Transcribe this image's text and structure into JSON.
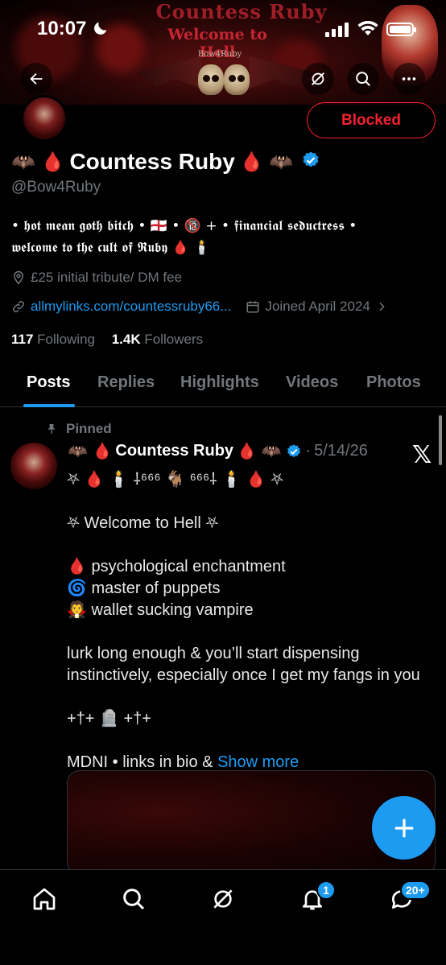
{
  "status_bar": {
    "time": "10:07"
  },
  "banner": {
    "title": "Countess Ruby",
    "subtitle": "Welcome to Hell",
    "tag": "Bow4Ruby"
  },
  "profile": {
    "display_name": "Countess Ruby",
    "name_prefix_emoji": "🦇 🩸",
    "name_suffix_emoji": "🩸 🦇",
    "handle": "@Bow4Ruby",
    "verified": true,
    "relationship_button": "Blocked",
    "bio_line1": "• 𝖍𝖔𝖙 𝖒𝖊𝖆𝖓 𝖌𝖔𝖙𝖍 𝖇𝖎𝖙𝖈𝖍 • 🏴󠁧󠁢󠁥󠁮󠁧󠁿 • 🔞 + • 𝖋𝖎𝖓𝖆𝖓𝖈𝖎𝖆𝖑 𝖘𝖊𝖉𝖚𝖈𝖙𝖗𝖊𝖘𝖘 •",
    "bio_line2": "𝖜𝖊𝖑𝖈𝖔𝖒𝖊 𝖙𝖔 𝖙𝖍𝖊 𝖈𝖚𝖑𝖙 𝖔𝖋 𝕽𝖚𝖇𝖞 🩸 🕯️",
    "location": "£25 initial tribute/ DM fee",
    "website": "allmylinks.com/countessruby66...",
    "joined": "Joined April 2024",
    "following_count": "117",
    "following_label": "Following",
    "followers_count": "1.4K",
    "followers_label": "Followers"
  },
  "tabs": [
    {
      "label": "Posts",
      "active": true
    },
    {
      "label": "Replies",
      "active": false
    },
    {
      "label": "Highlights",
      "active": false
    },
    {
      "label": "Videos",
      "active": false
    },
    {
      "label": "Photos",
      "active": false
    }
  ],
  "pinned_tweet": {
    "pinned_label": "Pinned",
    "author_name": "Countess Ruby",
    "name_prefix_emoji": "🦇 🩸",
    "name_suffix_emoji": "🩸 🦇",
    "separator": "·",
    "date": "5/14/26",
    "lines": [
      "⛧ 🩸 🕯️ ⸸⁶⁶⁶ 🐐 ⁶⁶⁶⸸ 🕯️ 🩸 ⛧",
      "",
      "⛧ Welcome to Hell ⛧",
      "",
      "🩸 psychological enchantment",
      "🌀 master of puppets",
      "🧛 wallet sucking vampire",
      "",
      "lurk long enough & you’ll start dispensing",
      "instinctively, especially once I get my fangs in you",
      "",
      "+†+ 🪦 +†+",
      ""
    ],
    "last_line": "MDNI • links in bio & ",
    "show_more": "Show more",
    "platform_icon": "x-logo-icon"
  },
  "bottom_nav": {
    "items": [
      "home-icon",
      "search-icon",
      "grok-icon",
      "notifications-icon",
      "messages-icon"
    ],
    "notifications_badge": "1",
    "messages_badge": "20+"
  },
  "colors": {
    "accent": "#1d9bf0",
    "blocked_red": "#f4212e",
    "muted": "#71767b",
    "background": "#000000"
  }
}
